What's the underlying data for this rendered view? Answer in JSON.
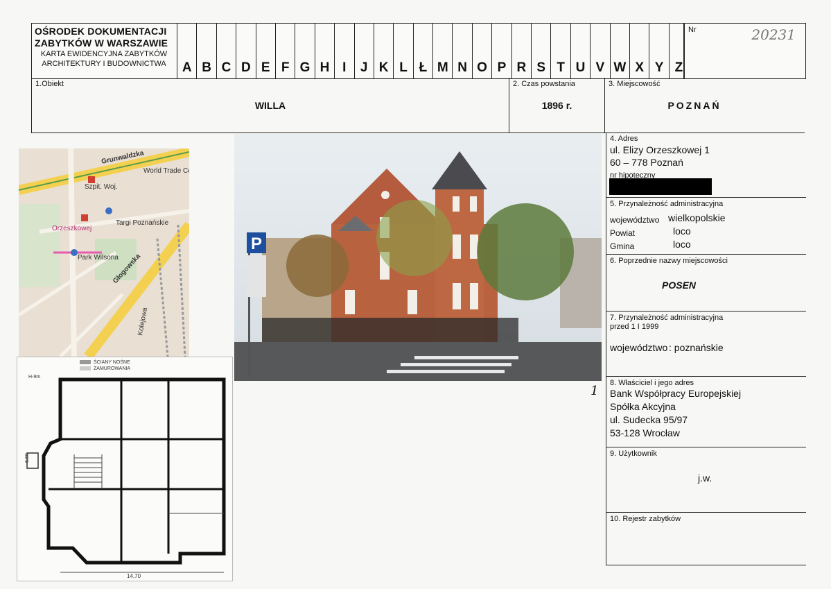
{
  "header": {
    "org_line1": "OŚRODEK DOKUMENTACJI",
    "org_line2": "ZABYTKÓW W WARSZAWIE",
    "org_line3": "KARTA EWIDENCYJNA ZABYTKÓW",
    "org_line4": "ARCHITEKTURY I BUDOWNICTWA",
    "letters": [
      "A",
      "B",
      "C",
      "D",
      "E",
      "F",
      "G",
      "H",
      "I",
      "J",
      "K",
      "L",
      "Ł",
      "M",
      "N",
      "O",
      "P",
      "R",
      "S",
      "T",
      "U",
      "V",
      "W",
      "X",
      "Y",
      "Z"
    ],
    "nr_label": "Nr",
    "nr_value": "20231"
  },
  "fields": {
    "obiekt_label": "1.Obiekt",
    "obiekt_value": "WILLA",
    "czas_label": "2. Czas powstania",
    "czas_value": "1896 r.",
    "miejscowosc_label": "3. Miejscowość",
    "miejscowosc_value": "POZNAŃ"
  },
  "adres": {
    "label": "4. Adres",
    "line1": "ul. Elizy Orzeszkowej 1",
    "line2": "60 – 778 Poznań",
    "hipoteczny": "nr hipoteczny"
  },
  "przynaleznosc": {
    "label": "5. Przynależność administracyjna",
    "woj_label": "województwo",
    "woj_value": "wielkopolskie",
    "powiat_label": "Powiat",
    "powiat_value": "loco",
    "gmina_label": "Gmina",
    "gmina_value": "loco"
  },
  "poprzednie": {
    "label": "6. Poprzednie nazwy miejscowości",
    "value": "POSEN"
  },
  "przed1999": {
    "label1": "7. Przynależność administracyjna",
    "label2": "przed 1 I 1999",
    "woj_label": "województwo",
    "woj_value": ": poznańskie"
  },
  "wlasciciel": {
    "label": "8. Właściciel i jego adres",
    "line1": "Bank Współpracy Europejskiej",
    "line2": "Spółka Akcyjna",
    "line3": "ul. Sudecka 95/97",
    "line4": "53-128 Wrocław"
  },
  "uzytkownik": {
    "label": "9. Użytkownik",
    "value": "j.w."
  },
  "rejestr": {
    "label": "10. Rejestr zabytków"
  },
  "photo": {
    "number": "1",
    "parking_sign": "P"
  },
  "map": {
    "labels": [
      "Grunwaldzka",
      "Głogowska",
      "Szpit. Woj.",
      "Targi Poznańskie",
      "Park Wilsona",
      "Orzeszkowej",
      "World Trade Center",
      "Kolejowa"
    ]
  },
  "plan": {
    "width_label": "14,70",
    "legend1": "ŚCIANY NOŚNE",
    "legend2": "ZAMUROWANIA",
    "h_label": "H-9m",
    "side_label": "6,50"
  }
}
